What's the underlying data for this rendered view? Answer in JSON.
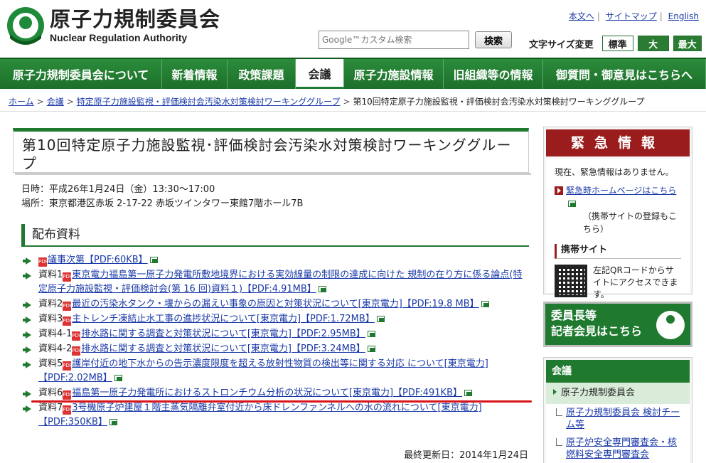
{
  "header": {
    "logo_jp": "原子力規制委員会",
    "logo_en": "Nuclear Regulation Authority",
    "toplinks": [
      "本文へ",
      "サイトマップ",
      "English"
    ],
    "search_placeholder": "Google™カスタム検索",
    "search_button": "検索",
    "fontsize_label": "文字サイズ変更",
    "fontsize_options": [
      "標準",
      "大",
      "最大"
    ]
  },
  "nav": [
    "原子力規制委員会について",
    "新着情報",
    "政策課題",
    "会議",
    "原子力施設情報",
    "旧組織等の情報",
    "御質問・御意見はこちらへ"
  ],
  "breadcrumb": [
    "ホーム",
    "会議",
    "特定原子力施設監視・評価検討会汚染水対策検討ワーキンググループ",
    "第10回特定原子力施設監視・評価検討会汚染水対策検討ワーキンググループ"
  ],
  "page_title": "第10回特定原子力施設監視･評価検討会汚染水対策検討ワーキンググループ",
  "meta": {
    "datetime_label": "日時：",
    "datetime": "平成26年1月24日（金）13:30～17:00",
    "place_label": "場所：",
    "place": "東京都港区赤坂 2-17-22 赤坂ツインタワー東館7階ホール7B"
  },
  "section_title": "配布資料",
  "documents": [
    {
      "prefix": "",
      "link": "議事次第【PDF:60KB】"
    },
    {
      "prefix": "資料1",
      "link": "東京電力福島第一原子力発電所敷地境界における実効線量の制限の達成に向けた 規制の在り方に係る論点(特定原子力施設監視・評価検討会(第 16 回)資料１)【PDF:4.91MB】"
    },
    {
      "prefix": "資料2",
      "link": "最近の汚染水タンク・堰からの漏えい事象の原因と対策状況について[東京電力]【PDF:19.8 MB】"
    },
    {
      "prefix": "資料3",
      "link": "主トレンチ凍結止水工事の進捗状況について[東京電力]【PDF:1.72MB】"
    },
    {
      "prefix": "資料4-1",
      "link": "排水路に関する調査と対策状況について[東京電力]【PDF:2.95MB】"
    },
    {
      "prefix": "資料4-2",
      "link": "排水路に関する調査と対策状況について[東京電力]【PDF:3.24MB】"
    },
    {
      "prefix": "資料5",
      "link": "護岸付近の地下水からの告示濃度限度を超える放射性物質の検出等に関する対応 について[東京電力]【PDF:2.02MB】"
    },
    {
      "prefix": "資料6",
      "link": "福島第一原子力発電所におけるストロンチウム分析の状況について[東京電力]【PDF:491KB】"
    },
    {
      "prefix": "資料7",
      "link": "3号機原子炉建屋１階主蒸気隔離弁室付近から床ドレンファンネルへの水の流れについて[東京電力]【PDF:350KB】"
    }
  ],
  "updated": "最終更新日：2014年1月24日",
  "sidebar": {
    "emergency_title": "緊急情報",
    "emergency_text": "現在、緊急情報はありません。",
    "emergency_link": "緊急時ホームページはこちら",
    "emergency_note": "（携帯サイトの登録もこちら）",
    "mobile_title": "携帯サイト",
    "mobile_text": "左記QRコードからサイトにアクセスできます。",
    "press_line1": "委員長等",
    "press_line2": "記者会見はこちら",
    "meetings_title": "会議",
    "meetings_selected": "原子力規制委員会",
    "meetings_items": [
      "原子力規制委員会 検討チーム等",
      "原子炉安全専門審査会・核燃料安全専門審査会"
    ]
  }
}
